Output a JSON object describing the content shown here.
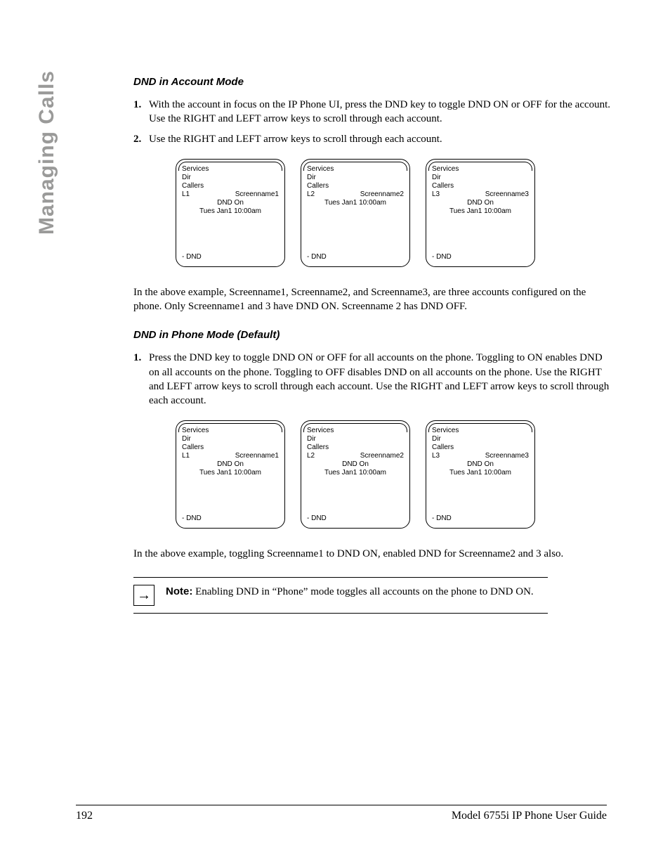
{
  "side_tab": "Managing Calls",
  "section1": {
    "heading": "DND in Account Mode",
    "steps": [
      {
        "num": "1.",
        "text": "With the account in focus on the IP Phone UI, press the DND key to toggle DND ON or OFF for the account. Use the RIGHT and LEFT arrow keys to scroll through each account."
      },
      {
        "num": "2.",
        "text": "Use the RIGHT and LEFT arrow keys to scroll through each account."
      }
    ],
    "screens": [
      {
        "services": "Services",
        "dir": "Dir",
        "callers": "Callers",
        "line": "L1",
        "name": "Screenname1",
        "status": "DND On",
        "time": "Tues Jan1 10:00am",
        "dnd": "- DND"
      },
      {
        "services": "Services",
        "dir": "Dir",
        "callers": "Callers",
        "line": "L2",
        "name": "Screenname2",
        "status": "",
        "time": "Tues Jan1 10:00am",
        "dnd": "- DND"
      },
      {
        "services": "Services",
        "dir": "Dir",
        "callers": "Callers",
        "line": "L3",
        "name": "Screenname3",
        "status": "DND On",
        "time": "Tues Jan1 10:00am",
        "dnd": "- DND"
      }
    ],
    "caption": "In the above example, Screenname1, Screenname2, and Screenname3, are three accounts configured on the phone. Only Screenname1 and 3 have DND ON. Screenname 2 has DND OFF."
  },
  "section2": {
    "heading": "DND in Phone Mode (Default)",
    "steps": [
      {
        "num": "1.",
        "text": "Press the DND key to toggle DND ON or OFF for all accounts on the phone. Toggling to ON enables DND on all accounts on the phone. Toggling to OFF disables DND on all accounts on the phone. Use the RIGHT and LEFT arrow keys to scroll through each account. Use the RIGHT and LEFT arrow keys to scroll through each account."
      }
    ],
    "screens": [
      {
        "services": "Services",
        "dir": "Dir",
        "callers": "Callers",
        "line": "L1",
        "name": "Screenname1",
        "status": "DND On",
        "time": "Tues Jan1 10:00am",
        "dnd": "- DND"
      },
      {
        "services": "Services",
        "dir": "Dir",
        "callers": "Callers",
        "line": "L2",
        "name": "Screenname2",
        "status": "DND On",
        "time": "Tues Jan1 10:00am",
        "dnd": "- DND"
      },
      {
        "services": "Services",
        "dir": "Dir",
        "callers": "Callers",
        "line": "L3",
        "name": "Screenname3",
        "status": "DND On",
        "time": "Tues Jan1 10:00am",
        "dnd": "- DND"
      }
    ],
    "caption": "In the above example, toggling Screenname1 to DND ON, enabled DND for Screenname2 and 3 also."
  },
  "note": {
    "label": "Note:",
    "text": " Enabling DND in “Phone” mode toggles all accounts on the phone to DND ON."
  },
  "footer": {
    "page": "192",
    "guide": "Model 6755i IP Phone User Guide"
  }
}
